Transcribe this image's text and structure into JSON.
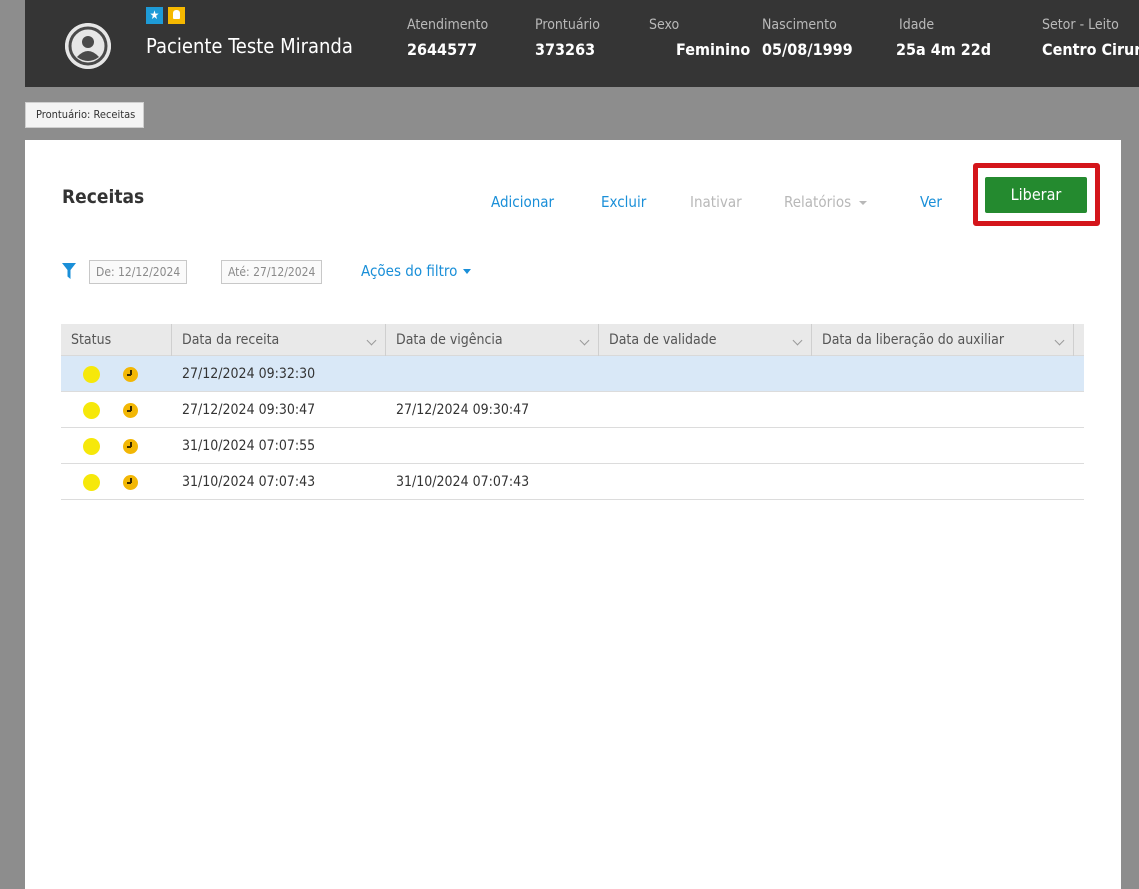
{
  "header": {
    "patient_name": "Paciente Teste Miranda",
    "fields": [
      {
        "label": "Atendimento",
        "value": "2644577"
      },
      {
        "label": "Prontuário",
        "value": "373263"
      },
      {
        "label": "Sexo",
        "value": "Feminino"
      },
      {
        "label": "Nascimento",
        "value": "05/08/1999"
      },
      {
        "label": "Idade",
        "value": "25a 4m 22d"
      },
      {
        "label": "Setor - Leito",
        "value": "Centro Cirurg"
      }
    ]
  },
  "breadcrumb": "Prontuário: Receitas",
  "page": {
    "title": "Receitas",
    "toolbar": {
      "add": "Adicionar",
      "delete": "Excluir",
      "inactivate": "Inativar",
      "reports": "Relatórios",
      "view": "Ver",
      "release": "Liberar"
    }
  },
  "filter": {
    "from": "De: 12/12/2024",
    "to": "Até: 27/12/2024",
    "actions": "Ações do filtro"
  },
  "table": {
    "columns": [
      "Status",
      "Data da receita",
      "Data de vigência",
      "Data de validade",
      "Data da liberação do auxiliar"
    ],
    "rows": [
      {
        "data_receita": "27/12/2024 09:32:30",
        "data_vigencia": "",
        "data_validade": "",
        "data_liberacao": ""
      },
      {
        "data_receita": "27/12/2024 09:30:47",
        "data_vigencia": "27/12/2024 09:30:47",
        "data_validade": "",
        "data_liberacao": ""
      },
      {
        "data_receita": "31/10/2024 07:07:55",
        "data_vigencia": "",
        "data_validade": "",
        "data_liberacao": ""
      },
      {
        "data_receita": "31/10/2024 07:07:43",
        "data_vigencia": "31/10/2024 07:07:43",
        "data_validade": "",
        "data_liberacao": ""
      }
    ]
  },
  "colors": {
    "header_bg": "#353535",
    "link_blue": "#1a8fd8",
    "release_green": "#248a2f",
    "highlight_red": "#d4151b",
    "status_yellow": "#f6e80a",
    "clock_amber": "#f2b705",
    "selected_row": "#d9e8f7"
  },
  "icons": {
    "avatar": "user-avatar-icon",
    "star": "star-icon",
    "bell": "bell-icon",
    "filter": "filter-icon",
    "status": "status-dot-icon",
    "pending": "clock-icon"
  }
}
